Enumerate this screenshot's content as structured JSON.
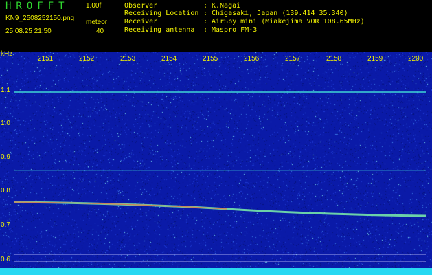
{
  "header": {
    "app_title": "HROFFT",
    "version": "1.00f",
    "filename": "KN9_2508252150.png",
    "datetime": "25.08.25 21:50",
    "meteor_label": "meteor",
    "meteor_count": "40"
  },
  "info": [
    {
      "key": "Observer",
      "value": "K.Nagai"
    },
    {
      "key": "Receiving Location",
      "value": "Chigasaki, Japan (139.414 35.340)"
    },
    {
      "key": "Receiver",
      "value": "AirSpy mini (Miakejima VOR 108.65MHz)"
    },
    {
      "key": "Receiving antenna",
      "value": "Maspro FM-3"
    }
  ],
  "axis": {
    "unit": "kHz",
    "y_ticks": [
      "1.1",
      "1.0",
      "0.9",
      "0.8",
      "0.7",
      "0.6"
    ],
    "x_ticks": [
      "2151",
      "2152",
      "2153",
      "2154",
      "2155",
      "2156",
      "2157",
      "2158",
      "2159",
      "2200"
    ]
  },
  "colors": {
    "background": "#000000",
    "plot": "#0a1aa8",
    "text": "#f2f200",
    "title": "#2fd62f",
    "line": "#3fd6d6",
    "trail": "#7cf2a8"
  }
}
